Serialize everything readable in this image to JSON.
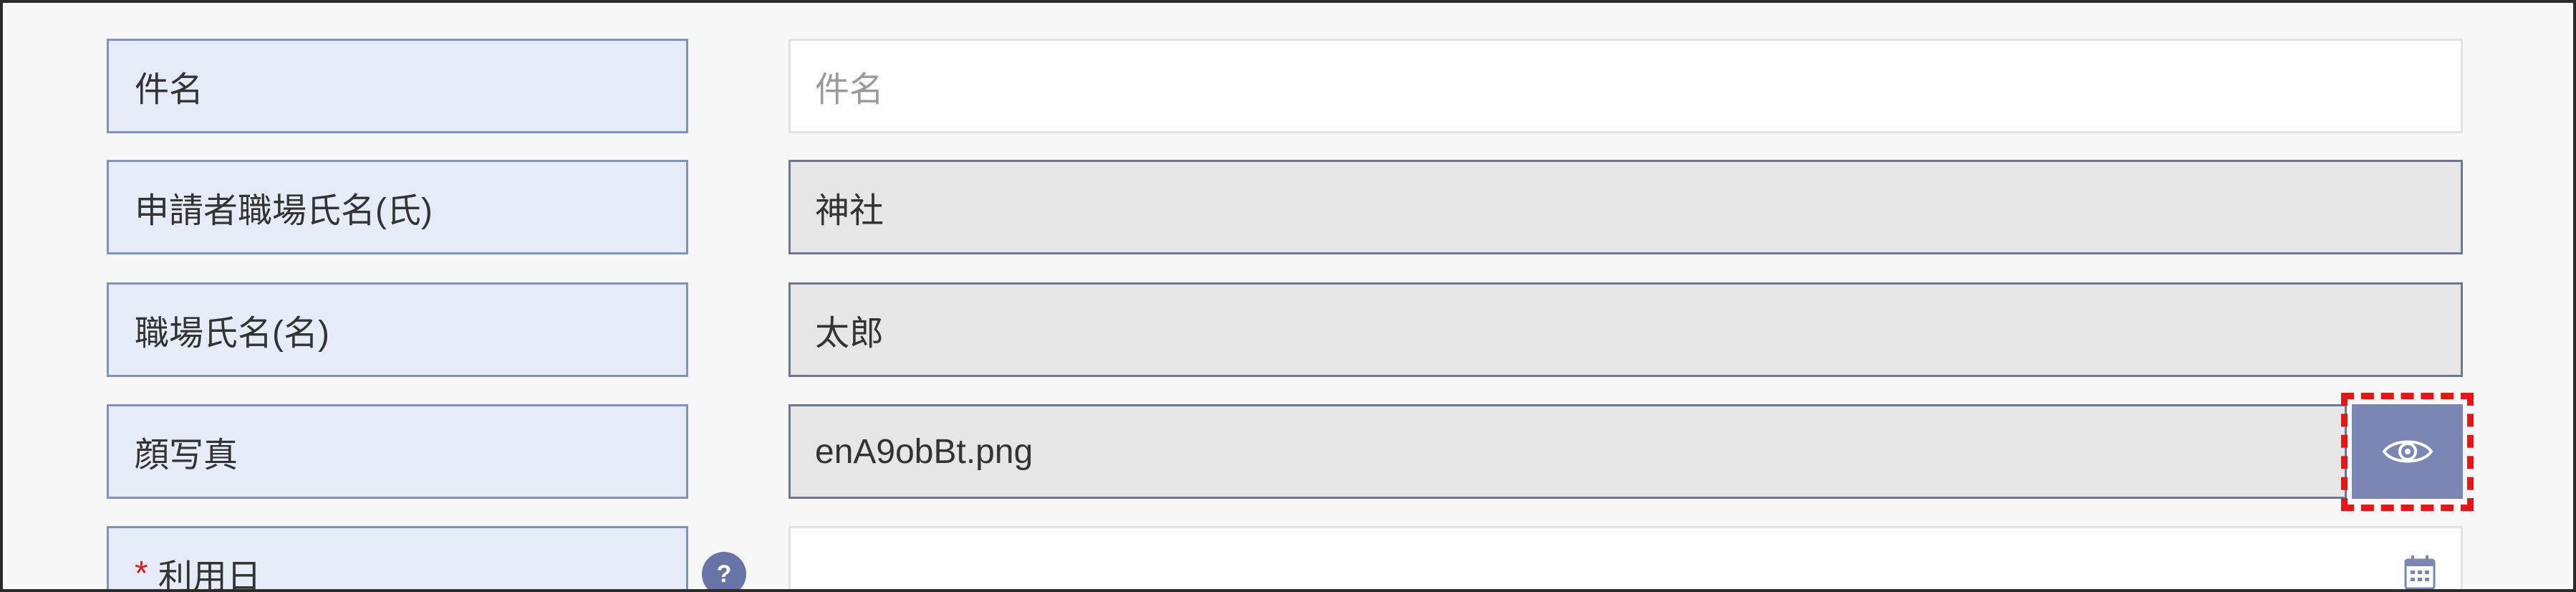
{
  "form": {
    "rows": [
      {
        "label": "件名",
        "placeholder": "件名",
        "value": ""
      },
      {
        "label": "申請者職場氏名(氏)",
        "value": "神社"
      },
      {
        "label": "職場氏名(名)",
        "value": "太郎"
      },
      {
        "label": "顔写真",
        "value": "enA9obBt.png",
        "action_icon": "eye-icon"
      },
      {
        "label": "利用日",
        "required_mark": "*",
        "help_label": "?",
        "value": "",
        "action_icon": "calendar-icon"
      }
    ]
  },
  "colors": {
    "label_bg": "#e6ecf7",
    "label_border": "#7f93bd",
    "readonly_bg": "#e6e6e6",
    "button_bg": "#7b86b5",
    "highlight": "#e01818",
    "required": "#d81e1e"
  }
}
